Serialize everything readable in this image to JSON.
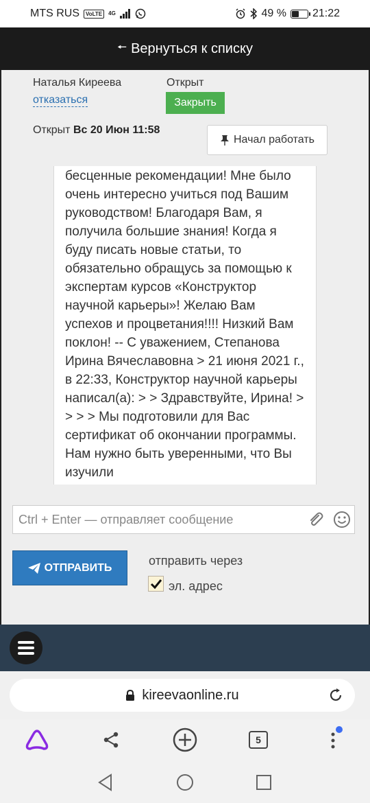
{
  "status_bar": {
    "carrier": "MTS RUS",
    "volte": "VoLTE",
    "network": "4G",
    "battery": "49 %",
    "battery_level": 0.49,
    "time": "21:22"
  },
  "top_bar": {
    "back_label": "Вернуться к списку"
  },
  "ticket": {
    "author": "Наталья Киреева",
    "refuse_link": "отказаться",
    "status_label": "Открыт",
    "close_button": "Закрыть",
    "opened_prefix": "Открыт",
    "opened_date": "Вс 20 Июн 11:58",
    "start_work_button": "Начал работать"
  },
  "message": {
    "text": "бесценные рекомендации! Мне было очень интересно учиться под Вашим руководством! Благодаря Вам, я получила большие знания! Когда я буду писать новые статьи, то обязательно обращусь за помощью к экспертам курсов «Конструктор научной карьеры»! Желаю Вам успехов и процветания!!!! Низкий Вам поклон! -- С уважением, Степанова Ирина Вячеславовна > 21 июня 2021 г., в 22:33, Конструктор научной карьеры написал(а): > > Здравствуйте, Ирина! > > > > Мы подготовили для Вас сертификат об окончании программы. Нам нужно быть уверенными, что Вы изучили"
  },
  "compose": {
    "placeholder": "Ctrl + Enter — отправляет сообщение",
    "send_button": "ОТПРАВИТЬ",
    "send_via_label": "отправить через",
    "email_option": "эл. адрес",
    "email_checked": true
  },
  "browser": {
    "url": "kireevaonline.ru",
    "tab_count": "5"
  },
  "colors": {
    "dark_bar": "#1b1b1b",
    "close_green": "#4caf50",
    "send_blue": "#2f7bbf",
    "menu_navy": "#2c3e50",
    "link_blue": "#2a6fb0",
    "alice_purple": "#8a2be2",
    "badge_blue": "#3d6df2"
  }
}
